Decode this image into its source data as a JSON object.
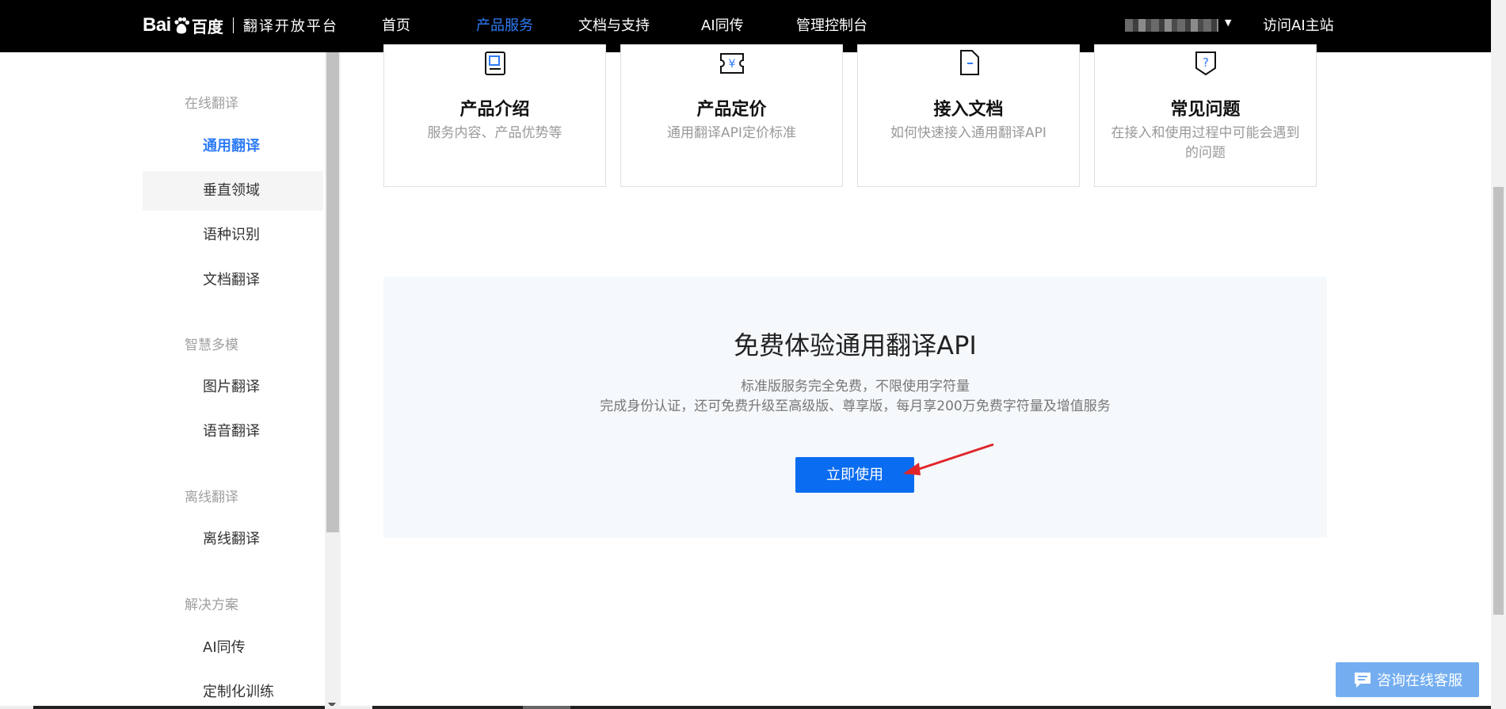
{
  "header": {
    "logo_text": "Bai",
    "logo_du": "du",
    "logo_baidu": "百度",
    "logo_subtitle": "翻译开放平台",
    "nav": [
      "首页",
      "产品服务",
      "文档与支持",
      "AI同传",
      "管理控制台"
    ],
    "active_nav": "产品服务",
    "visit_ai": "访问AI主站",
    "user_caret": "▼"
  },
  "sidebar": {
    "groups": [
      {
        "title": "在线翻译",
        "items": [
          "通用翻译",
          "垂直领域",
          "语种识别",
          "文档翻译"
        ]
      },
      {
        "title": "智慧多模",
        "items": [
          "图片翻译",
          "语音翻译"
        ]
      },
      {
        "title": "离线翻译",
        "items": [
          "离线翻译"
        ]
      },
      {
        "title": "解决方案",
        "items": [
          "AI同传",
          "定制化训练"
        ]
      }
    ],
    "active_item": "通用翻译",
    "hover_item": "垂直领域"
  },
  "cards": [
    {
      "title": "产品介绍",
      "desc": "服务内容、产品优势等",
      "icon": "doc-intro-icon"
    },
    {
      "title": "产品定价",
      "desc": "通用翻译API定价标准",
      "icon": "yuan-price-icon"
    },
    {
      "title": "接入文档",
      "desc": "如何快速接入通用翻译API",
      "icon": "file-doc-icon"
    },
    {
      "title": "常见问题",
      "desc": "在接入和使用过程中可能会遇到的问题",
      "icon": "question-shield-icon"
    }
  ],
  "promo": {
    "title": "免费体验通用翻译API",
    "line1": "标准版服务完全免费，不限使用字符量",
    "line2": "完成身份认证，还可免费升级至高级版、尊享版，每月享200万免费字符量及增值服务",
    "button": "立即使用"
  },
  "chat": {
    "label": "咨询在线客服",
    "icon": "chat-icon"
  },
  "colors": {
    "accent": "#2e7cf6",
    "button": "#0a6cf0",
    "chat": "#74aef0",
    "promo_bg": "#f5f9fc",
    "arrow": "#e0262a"
  }
}
